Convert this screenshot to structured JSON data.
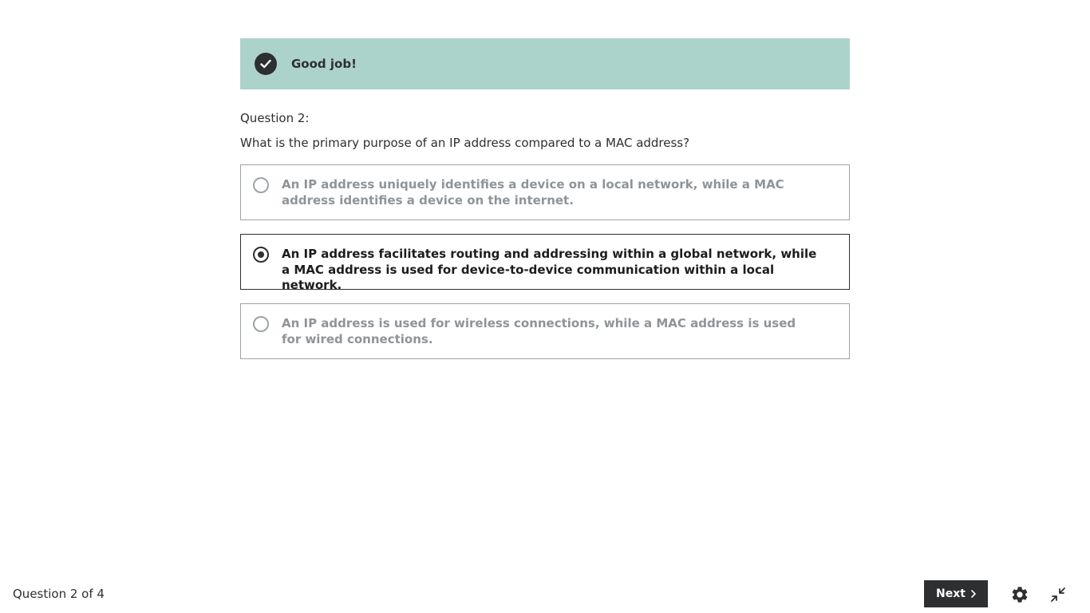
{
  "feedback": {
    "message": "Good job!",
    "icon": "check-circle-icon",
    "background_color": "#acd2cc"
  },
  "question": {
    "number_label": "Question 2:",
    "prompt": "What is the primary purpose of an IP address compared to a MAC address?",
    "options": [
      {
        "text": "An IP address uniquely identifies a device on a local network, while a MAC address identifies a device on the internet.",
        "selected": false
      },
      {
        "text": "An IP address facilitates routing and addressing within a global network, while a MAC address is used for device-to-device communication within a local network.",
        "selected": true
      },
      {
        "text": "An IP address is used for wireless connections, while a MAC address is used for wired connections.",
        "selected": false
      }
    ]
  },
  "footer": {
    "progress": "Question 2 of 4",
    "next_label": "Next",
    "next_icon": "chevron-right-icon",
    "settings_icon": "gear-icon",
    "collapse_icon": "exit-fullscreen-icon"
  },
  "colors": {
    "dark": "#2d2f31",
    "muted_text": "#8e9498",
    "border": "#9da3a7"
  }
}
